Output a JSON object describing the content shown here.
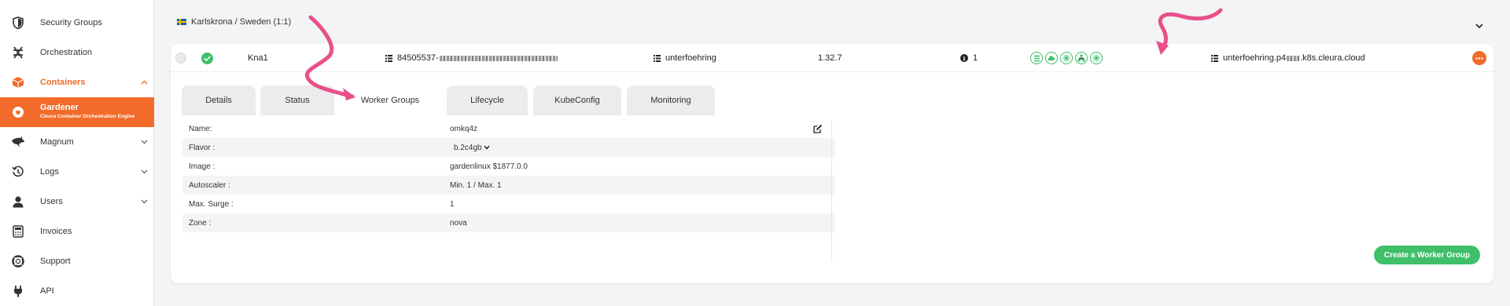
{
  "sidebar": {
    "items": [
      {
        "label": "Security Groups",
        "icon": "shield-icon"
      },
      {
        "label": "Orchestration",
        "icon": "orchestration-icon"
      },
      {
        "label": "Containers",
        "icon": "container-box-icon"
      },
      {
        "label": "Gardener",
        "sublabel": "Cleura Container Orchestration Engine",
        "icon": "gardener-icon"
      },
      {
        "label": "Magnum",
        "icon": "shark-icon"
      },
      {
        "label": "Logs",
        "icon": "history-icon"
      },
      {
        "label": "Users",
        "icon": "user-icon"
      },
      {
        "label": "Invoices",
        "icon": "calculator-icon"
      },
      {
        "label": "Support",
        "icon": "lifebuoy-icon"
      },
      {
        "label": "API",
        "icon": "plug-icon"
      }
    ]
  },
  "region": {
    "label": "Karlskrona / Sweden (1:1)"
  },
  "cluster": {
    "name": "Kna1",
    "id_prefix": "84505537-",
    "project": "unterfoehring",
    "version": "1.32.7",
    "node_count": "1",
    "domain_prefix": "unterfoehring.p4",
    "domain_suffix": ".k8s.cleura.cloud"
  },
  "tabs": [
    {
      "label": "Details"
    },
    {
      "label": "Status"
    },
    {
      "label": "Worker Groups"
    },
    {
      "label": "Lifecycle"
    },
    {
      "label": "KubeConfig"
    },
    {
      "label": "Monitoring"
    }
  ],
  "worker_group": [
    {
      "key": "Name:",
      "value": "omkq4z"
    },
    {
      "key": "Flavor :",
      "value": "b.2c4gb"
    },
    {
      "key": "Image :",
      "value": "gardenlinux $1877.0.0"
    },
    {
      "key": "Autoscaler :",
      "value": "Min. 1 / Max. 1"
    },
    {
      "key": "Max. Surge :",
      "value": "1"
    },
    {
      "key": "Zone :",
      "value": "nova"
    }
  ],
  "actions": {
    "create_worker_group": "Create a Worker Group"
  },
  "colors": {
    "accent": "#f26b2a",
    "success": "#3fbf6a",
    "annotation": "#e8508a"
  }
}
